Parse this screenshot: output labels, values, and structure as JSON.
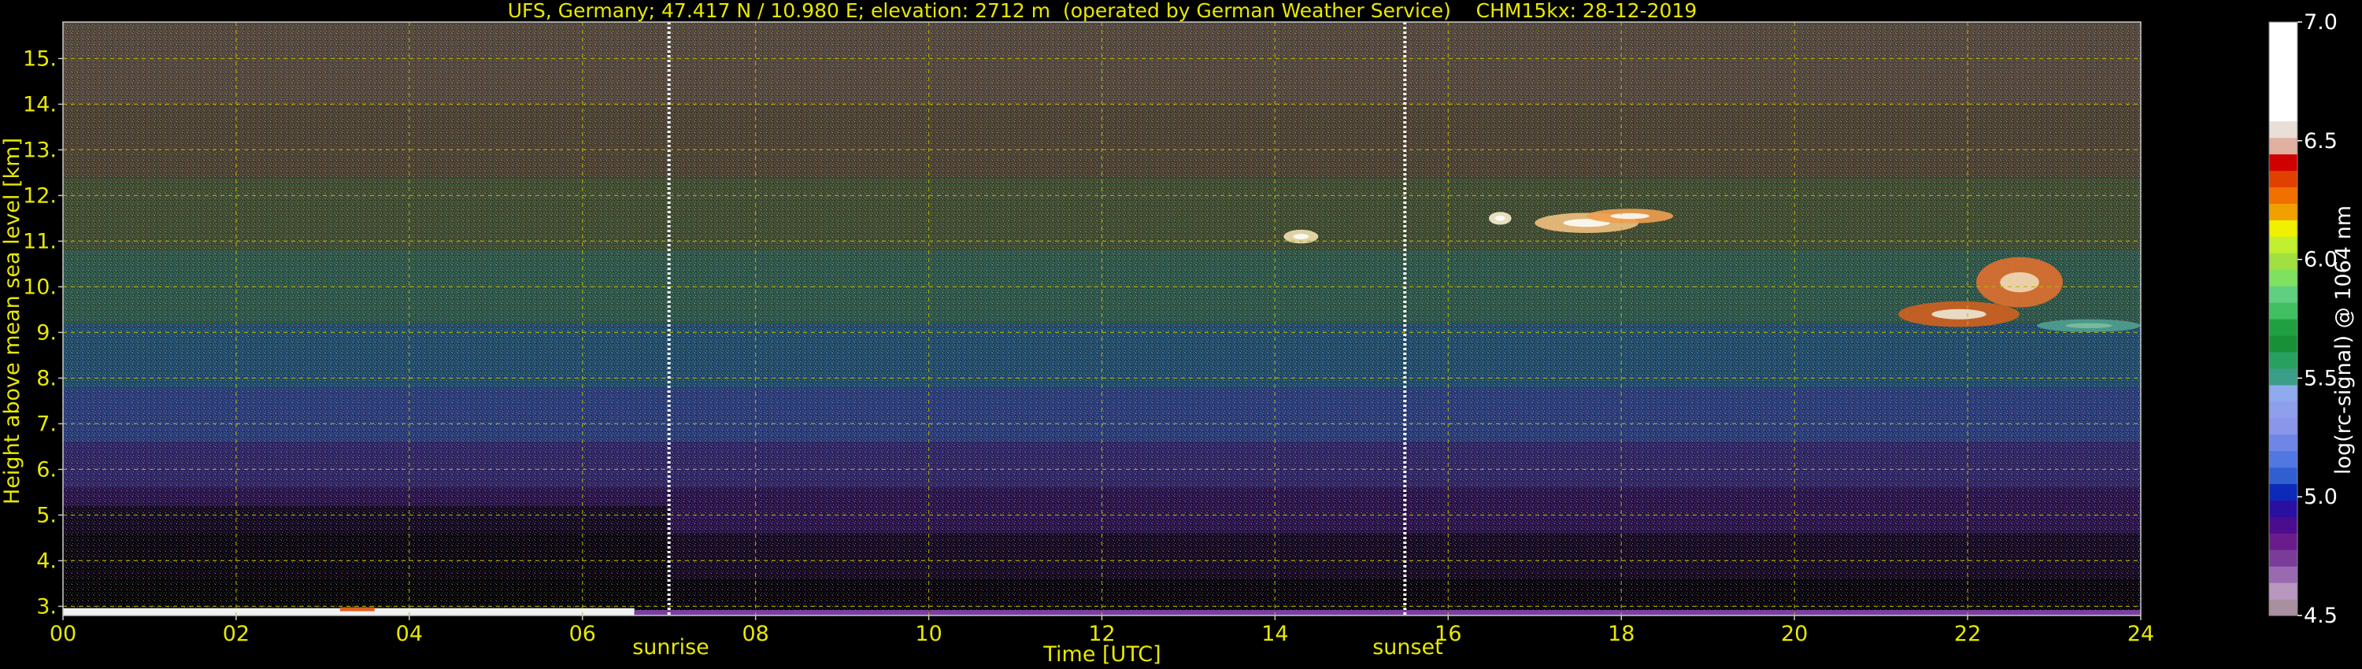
{
  "chart_data": {
    "type": "heatmap",
    "title": "UFS, Germany; 47.417 N / 10.980 E; elevation: 2712 m  (operated by German Weather Service)    CHM15kx: 28-12-2019",
    "xlabel": "Time [UTC]",
    "ylabel": "Height above mean sea level [km]",
    "xlim": [
      0,
      24
    ],
    "ylim": [
      2.8,
      15.8
    ],
    "x_tick_labels": [
      "00",
      "02",
      "04",
      "06",
      "08",
      "10",
      "12",
      "14",
      "16",
      "18",
      "20",
      "22",
      "24"
    ],
    "y_tick_labels": [
      "3.",
      "4.",
      "5.",
      "6.",
      "7.",
      "8.",
      "9.",
      "10.",
      "11.",
      "12.",
      "13.",
      "14.",
      "15."
    ],
    "grid": true,
    "colorbar": {
      "label": "log(rc-signal) @ 1064 nm",
      "range": [
        4.5,
        7.0
      ],
      "tick_labels": [
        "4.5",
        "5.0",
        "5.5",
        "6.0",
        "6.5",
        "7.0"
      ]
    },
    "annotations": [
      {
        "label": "sunrise",
        "time": 7.0
      },
      {
        "label": "sunset",
        "time": 15.5
      }
    ]
  },
  "colors": {
    "text": "#e8e800",
    "grid": "#b8b800",
    "background": "#000000"
  }
}
